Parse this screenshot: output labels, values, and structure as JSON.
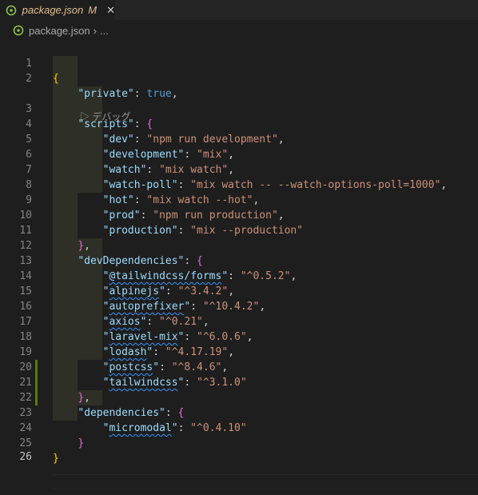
{
  "tab": {
    "title": "package.json",
    "status": "M"
  },
  "breadcrumb": {
    "file": "package.json",
    "separator": "›",
    "more": "..."
  },
  "codelens": "デバッグ",
  "code": {
    "lines": [
      {
        "num": "1"
      },
      {
        "num": "2"
      },
      {
        "num": "3"
      },
      {
        "num": "4"
      },
      {
        "num": "5"
      },
      {
        "num": "6"
      },
      {
        "num": "7"
      },
      {
        "num": "8"
      },
      {
        "num": "9"
      },
      {
        "num": "10"
      },
      {
        "num": "11"
      },
      {
        "num": "12"
      },
      {
        "num": "13"
      },
      {
        "num": "14"
      },
      {
        "num": "15"
      },
      {
        "num": "16"
      },
      {
        "num": "17"
      },
      {
        "num": "18"
      },
      {
        "num": "19"
      },
      {
        "num": "20"
      },
      {
        "num": "21"
      },
      {
        "num": "22"
      },
      {
        "num": "23"
      },
      {
        "num": "24"
      },
      {
        "num": "25"
      },
      {
        "num": "26"
      }
    ],
    "private": {
      "key": "\"private\"",
      "value": "true"
    },
    "scripts": {
      "key": "\"scripts\"",
      "items": [
        {
          "key": "\"dev\"",
          "value": "\"npm run development\""
        },
        {
          "key": "\"development\"",
          "value": "\"mix\""
        },
        {
          "key": "\"watch\"",
          "value": "\"mix watch\""
        },
        {
          "key": "\"watch-poll\"",
          "value": "\"mix watch -- --watch-options-poll=1000\""
        },
        {
          "key": "\"hot\"",
          "value": "\"mix watch --hot\""
        },
        {
          "key": "\"prod\"",
          "value": "\"npm run production\""
        },
        {
          "key": "\"production\"",
          "value": "\"mix --production\""
        }
      ]
    },
    "devDependencies": {
      "key": "\"devDependencies\"",
      "items": [
        {
          "key": "@tailwindcss/forms",
          "value": "\"^0.5.2\""
        },
        {
          "key": "alpinejs",
          "value": "\"^3.4.2\""
        },
        {
          "key": "autoprefixer",
          "value": "\"^10.4.2\""
        },
        {
          "key": "axios",
          "value": "\"^0.21\""
        },
        {
          "key": "laravel-mix",
          "value": "\"^6.0.6\""
        },
        {
          "key": "lodash",
          "value": "\"^4.17.19\""
        },
        {
          "key": "postcss",
          "value": "\"^8.4.6\""
        },
        {
          "key": "tailwindcss",
          "value": "\"^3.1.0\""
        }
      ]
    },
    "dependencies": {
      "key": "\"dependencies\"",
      "items": [
        {
          "key": "micromodal",
          "value": "\"^0.4.10\""
        }
      ]
    }
  },
  "colors": {
    "editor_bg": "#1e1e1e",
    "key": "#9cdcfe",
    "string": "#ce9178",
    "boolean": "#569cd6",
    "bracket_l1": "#ffd700",
    "bracket_l2": "#da70d6",
    "bracket_l3": "#179fff",
    "modified": "#e2c08d",
    "gutter_added": "#587c0c"
  }
}
